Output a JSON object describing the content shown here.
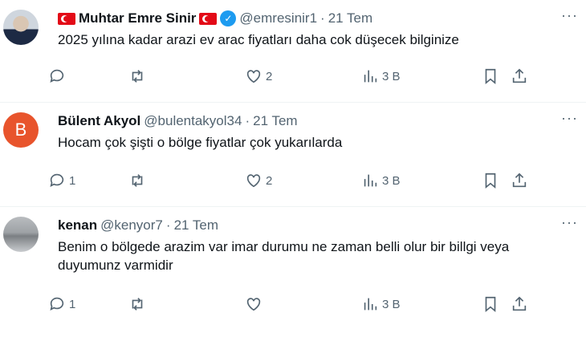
{
  "tweets": [
    {
      "name": "Muhtar Emre Sinir",
      "handle": "@emresinir1",
      "separator": "·",
      "date": "21 Tem",
      "text": "2025 yılına kadar arazi ev arac fiyatları daha cok düşecek bilginize",
      "replies": "",
      "retweets": "",
      "likes": "2",
      "views": "3 B"
    },
    {
      "avatar_letter": "B",
      "name": "Bülent Akyol",
      "handle": "@bulentakyol34",
      "separator": "·",
      "date": "21 Tem",
      "text": "Hocam çok şişti o bölge fiyatlar çok yukarılarda",
      "replies": "1",
      "retweets": "",
      "likes": "2",
      "views": "3 B"
    },
    {
      "name": "kenan",
      "handle": "@kenyor7",
      "separator": "·",
      "date": "21 Tem",
      "text": "Benim o bölgede arazim var imar durumu ne zaman belli olur bir billgi veya duyumunz varmidir",
      "replies": "1",
      "retweets": "",
      "likes": "",
      "views": "3 B"
    }
  ],
  "more_glyph": "···",
  "icons": [
    "reply-icon",
    "retweet-icon",
    "like-icon",
    "views-icon",
    "bookmark-icon",
    "share-icon",
    "verified-icon",
    "flag-icon"
  ],
  "colors": {
    "text": "#0f1419",
    "muted": "#536471",
    "verified": "#1d9bf0",
    "avatar_letter_bg": "#e8542c",
    "flag": "#e30a17"
  }
}
